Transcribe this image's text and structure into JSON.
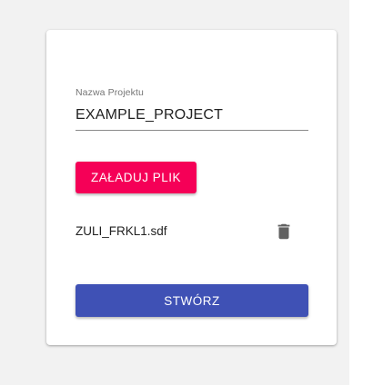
{
  "form": {
    "project_name": {
      "label": "Nazwa Projektu",
      "value": "EXAMPLE_PROJECT"
    },
    "upload_button_label": "ZAŁADUJ PLIK",
    "files": [
      {
        "name": "ZULI_FRKL1.sdf",
        "action_icon": "trash-icon"
      }
    ],
    "create_button_label": "STWÓRZ"
  },
  "colors": {
    "upload_button": "#f50057",
    "create_button": "#3f51b5",
    "icon": "#616161"
  }
}
